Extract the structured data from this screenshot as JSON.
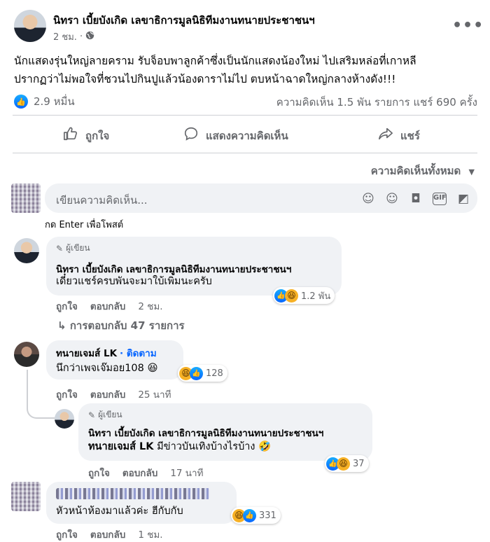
{
  "post": {
    "author": "นิทรา เบี้ยบังเกิด เลขาธิการมูลนิธิทีมงานทนายประชาชนฯ",
    "time": "2 ชม.",
    "audience_icon": "globe-icon",
    "text_line1": "นักแสดงรุ่นใหญ่ลายคราม รับจ็อบพาลูกค้าซึ่งเป็นนักแสดงน้องใหม่ ไปเสริมหล่อที่เกาหลี",
    "text_line2": "ปรากฏว่าไม่พอใจที่ชวนไปกินปูแล้วน้องดาราไม่ไป ตบหน้าฉาดใหญ่กลางห้างดัง!!!",
    "reactions": "2.9 หมื่น",
    "stats": "ความคิดเห็น 1.5 พัน รายการ  แชร์ 690 ครั้ง"
  },
  "actions": {
    "like": "ถูกใจ",
    "comment": "แสดงความคิดเห็น",
    "share": "แชร์"
  },
  "sort_label": "ความคิดเห็นทั้งหมด",
  "composer": {
    "placeholder": "เขียนความคิดเห็น...",
    "hint": "กด Enter เพื่อโพสต์"
  },
  "comments": [
    {
      "tag": "ผู้เขียน",
      "name": "นิทรา เบี้ยบังเกิด เลขาธิการมูลนิธิทีมงานทนายประชาชนฯ",
      "text": "เดี๋ยวแชร์ครบพันจะมาใบ้เพิ่มนะครับ",
      "reactions": "1.2 พัน",
      "like": "ถูกใจ",
      "reply": "ตอบกลับ",
      "time": "2 ชม.",
      "replies": "การตอบกลับ 47 รายการ"
    },
    {
      "name": "ทนายเจมส์ LK",
      "follow": "· ติดตาม",
      "text": "นึกว่าเพจเจ๊มอย108 😆",
      "reactions": "128",
      "like": "ถูกใจ",
      "reply": "ตอบกลับ",
      "time": "25 นาที"
    },
    {
      "tag": "ผู้เขียน",
      "name": "นิทรา เบี้ยบังเกิด เลขาธิการมูลนิธิทีมงานทนายประชาชนฯ",
      "prefix": "ทนายเจมส์ LK",
      "text": " มีข่าวบันเทิงบ้างไรบ้าง 🤣",
      "reactions": "37",
      "like": "ถูกใจ",
      "reply": "ตอบกลับ",
      "time": "17 นาที"
    },
    {
      "text": "หัวหน้าห้องมาแล้วค่ะ ฮีกับกับ",
      "reactions": "331",
      "like": "ถูกใจ",
      "reply": "ตอบกลับ",
      "time": "1 ชม."
    }
  ]
}
